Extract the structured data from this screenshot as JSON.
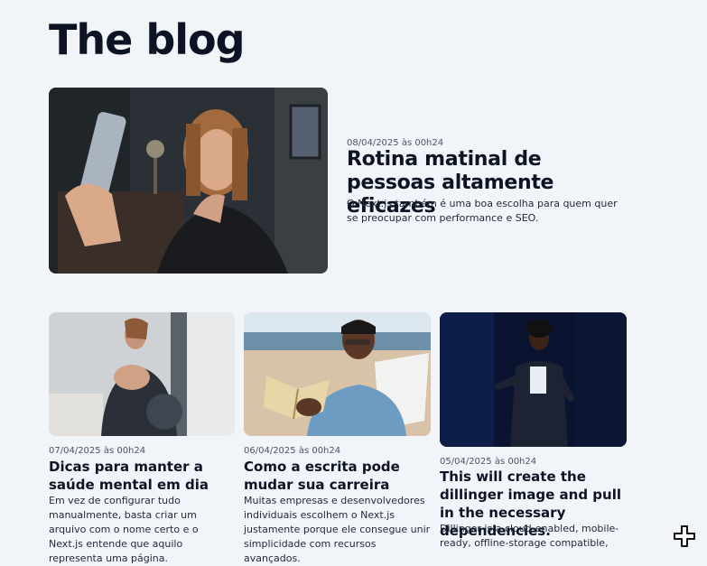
{
  "page": {
    "title": "The blog"
  },
  "featured": {
    "date": "08/04/2025 às 00h24",
    "title": "Rotina matinal de pessoas altamente eficazes",
    "excerpt": "O Next.js também é uma boa escolha para quem quer se preocupar com performance e SEO.",
    "image": "woman-taking-selfie"
  },
  "posts": [
    {
      "date": "07/04/2025 às 00h24",
      "title": "Dicas para manter a saúde mental em dia",
      "excerpt": "Em vez de configurar tudo manualmente, basta criar um arquivo com o nome certo e o Next.js entende que aquilo representa uma página.",
      "image": "woman-with-gym-bag"
    },
    {
      "date": "06/04/2025 às 00h24",
      "title": "Como a escrita pode mudar sua carreira",
      "excerpt": "Muitas empresas e desenvolvedores individuais escolhem o Next.js justamente porque ele consegue unir simplicidade com recursos avançados.",
      "image": "man-reading-on-beach"
    },
    {
      "date": "05/04/2025 às 00h24",
      "title": "This will create the dillinger image and pull in the necessary dependencies.",
      "excerpt": "Dillinger is a cloud-enabled, mobile-ready, offline-storage compatible,",
      "image": "woman-speaking-on-stage"
    }
  ],
  "icons": {
    "floating": "plus-icon"
  },
  "colors": {
    "background": "#f1f4f9",
    "text": "#0c1322",
    "muted": "#4b5563"
  }
}
